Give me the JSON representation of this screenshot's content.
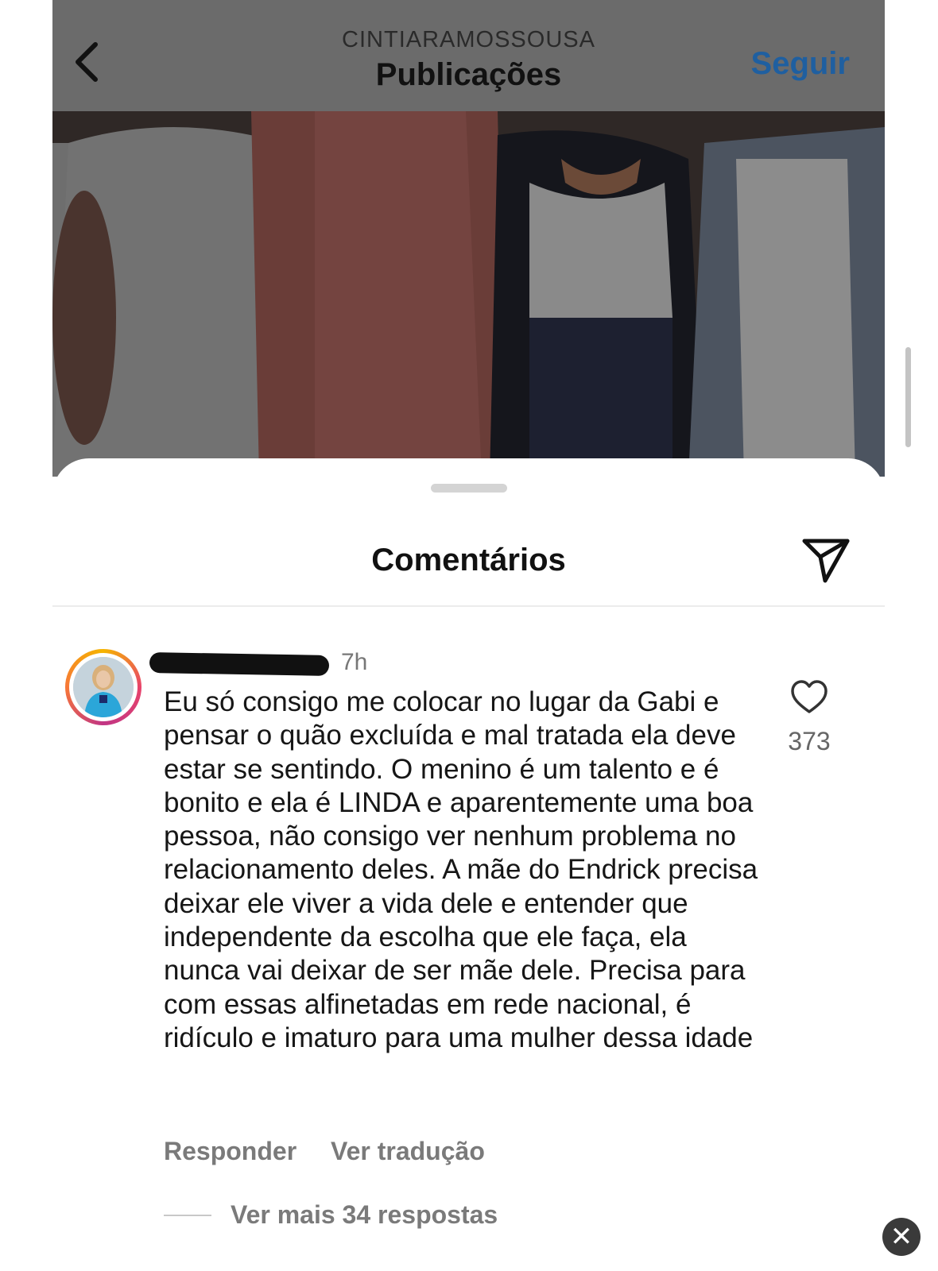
{
  "header": {
    "back_icon": "chevron-left-icon",
    "account_name": "CINTIARAMOSSOUSA",
    "title": "Publicações",
    "follow_label": "Seguir",
    "follow_color": "#1f5fa0"
  },
  "comments_sheet": {
    "title": "Comentários",
    "share_icon": "paper-plane-icon",
    "comment": {
      "username": "r",
      "time": "7h",
      "text": "Eu só consigo me colocar no lugar da Gabi e pensar o quão excluída e mal tratada ela deve estar se sentindo. O menino é um talento e é bonito e ela é LINDA e aparentemente uma boa pessoa, não consigo ver nenhum problema no relacionamento deles. A mãe do Endrick precisa deixar ele viver a vida dele e entender que independente da escolha que ele faça, ela nunca vai deixar de ser mãe dele. Precisa para com essas alfinetadas em rede nacional, é ridículo e imaturo para uma mulher dessa idade",
      "like_icon": "heart-outline-icon",
      "like_count": "373",
      "reply_label": "Responder",
      "translate_label": "Ver tradução",
      "more_replies_label": "Ver mais 34 respostas"
    }
  },
  "overlay": {
    "close_icon": "close-icon",
    "close_glyph": "✕"
  }
}
